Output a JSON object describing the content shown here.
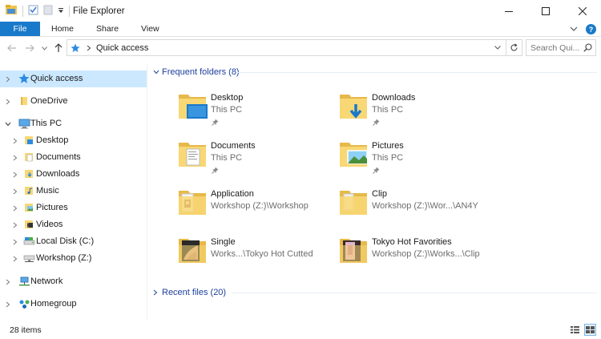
{
  "window": {
    "title": "File Explorer"
  },
  "ribbon": {
    "tabs": [
      {
        "label": "File"
      },
      {
        "label": "Home"
      },
      {
        "label": "Share"
      },
      {
        "label": "View"
      }
    ]
  },
  "address": {
    "breadcrumb": "Quick access",
    "search_placeholder": "Search Qui..."
  },
  "sidebar": {
    "items": [
      {
        "label": "Quick access",
        "icon": "star-icon"
      },
      {
        "label": "OneDrive",
        "icon": "folder-icon"
      },
      {
        "label": "This PC",
        "icon": "computer-icon"
      },
      {
        "label": "Desktop",
        "icon": "desktop-folder-icon"
      },
      {
        "label": "Documents",
        "icon": "documents-folder-icon"
      },
      {
        "label": "Downloads",
        "icon": "downloads-folder-icon"
      },
      {
        "label": "Music",
        "icon": "music-folder-icon"
      },
      {
        "label": "Pictures",
        "icon": "pictures-folder-icon"
      },
      {
        "label": "Videos",
        "icon": "videos-folder-icon"
      },
      {
        "label": "Local Disk (C:)",
        "icon": "disk-icon"
      },
      {
        "label": "Workshop (Z:)",
        "icon": "network-drive-icon"
      },
      {
        "label": "Network",
        "icon": "network-icon"
      },
      {
        "label": "Homegroup",
        "icon": "homegroup-icon"
      }
    ]
  },
  "main": {
    "frequent": {
      "header": "Frequent folders (8)",
      "folders": [
        {
          "name": "Desktop",
          "location": "This PC",
          "pinned": true
        },
        {
          "name": "Downloads",
          "location": "This PC",
          "pinned": true
        },
        {
          "name": "Documents",
          "location": "This PC",
          "pinned": true
        },
        {
          "name": "Pictures",
          "location": "This PC",
          "pinned": true
        },
        {
          "name": "Application",
          "location": "Workshop (Z:)\\Workshop",
          "pinned": false
        },
        {
          "name": "Clip",
          "location": "Workshop (Z:)\\Wor...\\AN4Y",
          "pinned": false
        },
        {
          "name": "Single",
          "location": "Works...\\Tokyo Hot Cutted",
          "pinned": false
        },
        {
          "name": "Tokyo Hot Favorities",
          "location": "Workshop (Z:)\\Works...\\Clip",
          "pinned": false
        }
      ]
    },
    "recent": {
      "header": "Recent files (20)"
    }
  },
  "status": {
    "item_count": "28 items"
  },
  "colors": {
    "accent": "#1979ca",
    "selection": "#cce8ff",
    "folder": "#f8d775",
    "group_header": "#1e3f9c"
  }
}
